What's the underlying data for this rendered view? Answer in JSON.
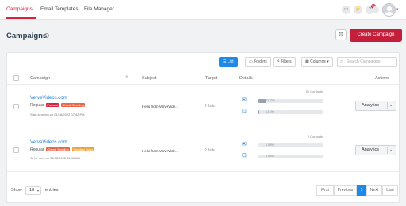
{
  "nav": {
    "tabs": [
      {
        "label": "Campaigns",
        "active": true
      },
      {
        "label": "Email Templates",
        "active": false
      },
      {
        "label": "File Manager",
        "active": false
      }
    ],
    "icons": [
      "inbox-icon",
      "lightning-icon",
      "help-icon",
      "notification-icon"
    ],
    "notification_count": "10"
  },
  "header": {
    "title": "Campaigns",
    "create_label": "Create Campaign"
  },
  "toolbar": {
    "list_label": "List",
    "folders_label": "Folders",
    "filters_label": "Filters",
    "columns_label": "Columns",
    "search_placeholder": "Search Campaigns"
  },
  "table": {
    "headers": [
      "Campaign",
      "Subject",
      "Target",
      "Details",
      "Actions"
    ],
    "rows": [
      {
        "name": "VerveVideos.com",
        "type": "Regular",
        "tags": [
          {
            "label": "Paused",
            "color": "#d6243f"
          },
          {
            "label": "Chunk Sending",
            "color": "#e8664a"
          }
        ],
        "date": "Start sending on 01/18/2022 07:42 PM",
        "subject": "Hello from VerveVide...",
        "target": "2 lists",
        "contacts": "90 Contacts",
        "bar1": {
          "label": "13.33%",
          "fraction": 0.13
        },
        "bar2": {
          "label": "1.11%",
          "fraction": 0.02
        }
      },
      {
        "name": "VerveVideos.com",
        "type": "Regular",
        "tags": [
          {
            "label": "Chunk Sending",
            "color": "#e8664a"
          },
          {
            "label": "Sending Soon",
            "color": "#f0a23a"
          }
        ],
        "date": "To be sent on 01/12/2022 11:45 AM",
        "subject": "Hello from VerveVide...",
        "target": "2 lists",
        "contacts": "0 Contacts",
        "bar1": {
          "label": "0.00%",
          "fraction": 0.0
        },
        "bar2": {
          "label": "0.00%",
          "fraction": 0.0
        }
      }
    ],
    "action_label": "Analytics"
  },
  "footer": {
    "show_label": "Show",
    "page_size": "10",
    "entries_label": "entries",
    "pager": [
      "First",
      "Previous",
      "1",
      "Next",
      "Last"
    ],
    "current_page": "1"
  },
  "colors": {
    "accent": "#d6243f",
    "primary_blue": "#1e8ae6",
    "link": "#1e7fd6"
  }
}
